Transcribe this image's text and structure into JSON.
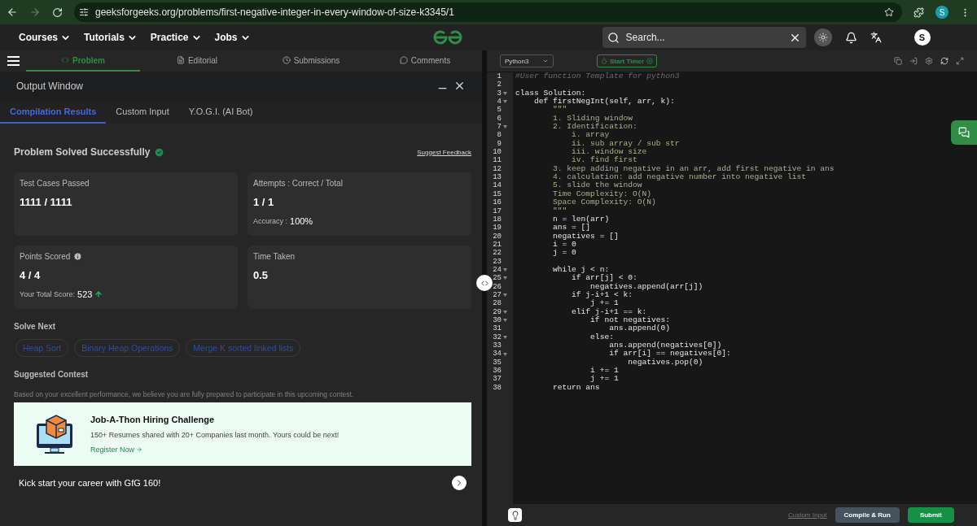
{
  "browser": {
    "url": "geeksforgeeks.org/problems/first-negative-integer-in-every-window-of-size-k3345/1",
    "profile": "S"
  },
  "nav": {
    "menus": [
      "Courses",
      "Tutorials",
      "Practice",
      "Jobs"
    ],
    "search": {
      "placeholder": "Search..."
    },
    "avatar": "S"
  },
  "problem_tabs": [
    {
      "label": "Problem",
      "selected": true
    },
    {
      "label": "Editorial",
      "selected": false
    },
    {
      "label": "Submissions",
      "selected": false
    },
    {
      "label": "Comments",
      "selected": false
    }
  ],
  "output_window": {
    "title": "Output Window",
    "tabs": [
      {
        "label": "Compilation Results",
        "selected": true
      },
      {
        "label": "Custom Input",
        "selected": false
      },
      {
        "label": "Y.O.G.I. (AI Bot)",
        "selected": false
      }
    ],
    "status": "Problem Solved Successfully",
    "feedback_link": "Suggest Feedback",
    "cards": [
      {
        "label": "Test Cases Passed",
        "value": "1111 / 1111"
      },
      {
        "label": "Attempts : Correct / Total",
        "value": "1 / 1",
        "note_label": "Accuracy :",
        "note_value": "100%"
      },
      {
        "label": "Points Scored",
        "value": "4 / 4",
        "info": true,
        "note_label": "Your Total Score:",
        "note_value": "523"
      },
      {
        "label": "Time Taken",
        "value": "0.5"
      }
    ],
    "solve_next": {
      "title": "Solve Next",
      "items": [
        "Heap Sort",
        "Binary Heap Operations",
        "Merge K sorted linked lists"
      ]
    },
    "contest": {
      "title": "Suggested Contest",
      "description": "Based on your excellent performance, we believe you are fully prepared to participate in this upcoming contest.",
      "banner": {
        "title": "Job-A-Thon Hiring Challenge",
        "text": "150+ Resumes shared with 20+ Companies last month. Yours could be next!",
        "link": "Register Now"
      }
    },
    "promo": "Kick start your career with GfG 160!"
  },
  "editor": {
    "language": "Python3",
    "timer": "Start Timer",
    "lines": [
      {
        "no": "1",
        "kind": "comment",
        "text": "#User function Template for python3",
        "fold": false
      },
      {
        "no": "2",
        "kind": "code",
        "fold": false
      },
      {
        "no": "3",
        "kind": "code",
        "text": "class Solution:",
        "fold": true
      },
      {
        "no": "4",
        "kind": "code",
        "text": "    def firstNegInt(self, arr, k):",
        "fold": true
      },
      {
        "no": "5",
        "kind": "doc",
        "text": "        \"\"\"",
        "fold": false
      },
      {
        "no": "6",
        "kind": "doc",
        "text": "        1. Sliding window",
        "fold": false
      },
      {
        "no": "7",
        "kind": "doc",
        "text": "        2. Identification:",
        "fold": true
      },
      {
        "no": "8",
        "kind": "doc",
        "text": "            i. array",
        "fold": false
      },
      {
        "no": "9",
        "kind": "doc",
        "text": "            ii. sub array / sub str",
        "fold": false
      },
      {
        "no": "10",
        "kind": "doc",
        "text": "            iii. window size",
        "fold": false
      },
      {
        "no": "11",
        "kind": "doc",
        "text": "            iv. find first",
        "fold": false
      },
      {
        "no": "12",
        "kind": "doc",
        "text": "        3. keep adding negative in an arr, add first negative in ans",
        "fold": false
      },
      {
        "no": "13",
        "kind": "doc",
        "text": "        4. calculation: add negative number into negative list",
        "fold": false
      },
      {
        "no": "14",
        "kind": "doc",
        "text": "        5. slide the window",
        "fold": false
      },
      {
        "no": "15",
        "kind": "doc",
        "text": "        Time Complexity: O(N)",
        "fold": false
      },
      {
        "no": "16",
        "kind": "doc",
        "text": "        Space Complexity: O(N)",
        "fold": false
      },
      {
        "no": "17",
        "kind": "doc",
        "text": "        \"\"\"",
        "fold": false
      },
      {
        "no": "18",
        "kind": "code",
        "text": "        n = len(arr)",
        "fold": false
      },
      {
        "no": "19",
        "kind": "code",
        "text": "        ans = []",
        "fold": false
      },
      {
        "no": "20",
        "kind": "code",
        "text": "        negatives = []",
        "fold": false
      },
      {
        "no": "21",
        "kind": "code",
        "text": "        i = 0",
        "fold": false
      },
      {
        "no": "22",
        "kind": "code",
        "text": "        j = 0",
        "fold": false
      },
      {
        "no": "23",
        "kind": "code",
        "fold": false
      },
      {
        "no": "24",
        "kind": "code",
        "text": "        while j < n:",
        "fold": true
      },
      {
        "no": "25",
        "kind": "code",
        "text": "            if arr[j] < 0:",
        "fold": true
      },
      {
        "no": "26",
        "kind": "code",
        "text": "                negatives.append(arr[j])",
        "fold": false
      },
      {
        "no": "27",
        "kind": "code",
        "text": "            if j-i+1 < k:",
        "fold": true
      },
      {
        "no": "28",
        "kind": "code",
        "text": "                j += 1",
        "fold": false
      },
      {
        "no": "29",
        "kind": "code",
        "text": "            elif j-i+1 == k:",
        "fold": true
      },
      {
        "no": "30",
        "kind": "code",
        "text": "                if not negatives:",
        "fold": true
      },
      {
        "no": "31",
        "kind": "code",
        "text": "                    ans.append(0)",
        "fold": false
      },
      {
        "no": "32",
        "kind": "code",
        "text": "                else:",
        "fold": true
      },
      {
        "no": "33",
        "kind": "code",
        "text": "                    ans.append(negatives[0])",
        "fold": false
      },
      {
        "no": "34",
        "kind": "code",
        "text": "                    if arr[i] == negatives[0]:",
        "fold": true
      },
      {
        "no": "35",
        "kind": "code",
        "text": "                        negatives.pop(0)",
        "fold": false
      },
      {
        "no": "36",
        "kind": "code",
        "text": "                i += 1",
        "fold": false
      },
      {
        "no": "37",
        "kind": "code",
        "text": "                j += 1",
        "fold": false
      },
      {
        "no": "38",
        "kind": "code",
        "text": "        return ans",
        "fold": false
      }
    ],
    "footer": {
      "custom_input": "Custom Input",
      "run": "Compile & Run",
      "submit": "Submit"
    }
  }
}
